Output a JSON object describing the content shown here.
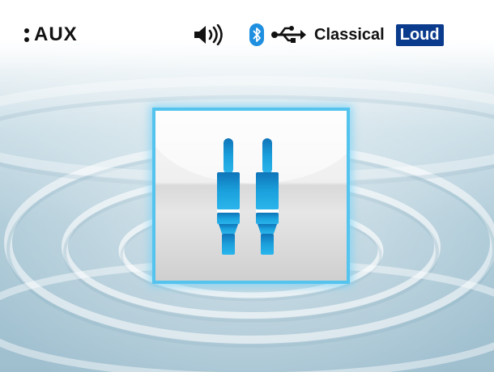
{
  "status_bar": {
    "source_label": "AUX",
    "eq_mode": "Classical",
    "loud_label": "Loud",
    "icons": [
      "source-menu-icon",
      "volume-icon",
      "bluetooth-icon",
      "usb-icon"
    ]
  },
  "main": {
    "source_tile_icon": "aux-cable-icon"
  },
  "colors": {
    "loud_badge_bg": "#0b3b8c",
    "bluetooth": "#1f8fe0",
    "tile_border": "#54c4ee",
    "aux_icon": "#1aa0dc"
  }
}
